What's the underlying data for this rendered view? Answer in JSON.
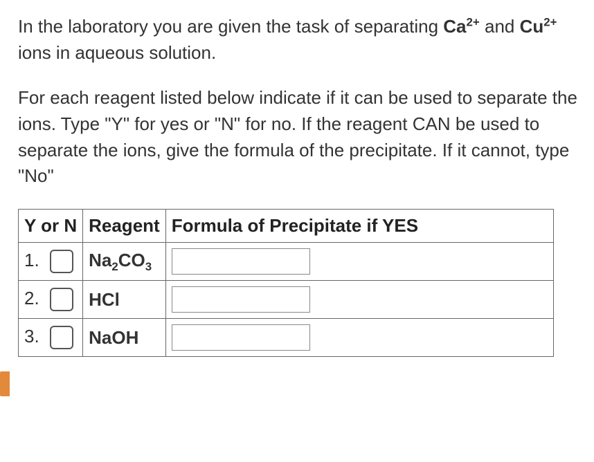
{
  "intro": {
    "part1": "In the laboratory you are given the task of separating ",
    "ion1_base": "Ca",
    "ion1_charge": "2+",
    "middle": " and ",
    "ion2_base": "Cu",
    "ion2_charge": "2+",
    "part2": " ions in aqueous solution."
  },
  "instructions": "For each reagent listed below indicate if it can be used to separate the ions. Type \"Y\" for yes or \"N\" for no. If the reagent CAN be used to separate the ions, give the formula of the precipitate. If it cannot, type \"No\"",
  "table": {
    "headers": {
      "yn": "Y or N",
      "reagent": "Reagent",
      "formula": "Formula of Precipitate if YES"
    },
    "rows": [
      {
        "num": "1.",
        "reagent_base": "Na",
        "reagent_sub1": "2",
        "reagent_mid": "CO",
        "reagent_sub2": "3"
      },
      {
        "num": "2.",
        "reagent_base": "HCl",
        "reagent_sub1": "",
        "reagent_mid": "",
        "reagent_sub2": ""
      },
      {
        "num": "3.",
        "reagent_base": "NaOH",
        "reagent_sub1": "",
        "reagent_mid": "",
        "reagent_sub2": ""
      }
    ]
  }
}
